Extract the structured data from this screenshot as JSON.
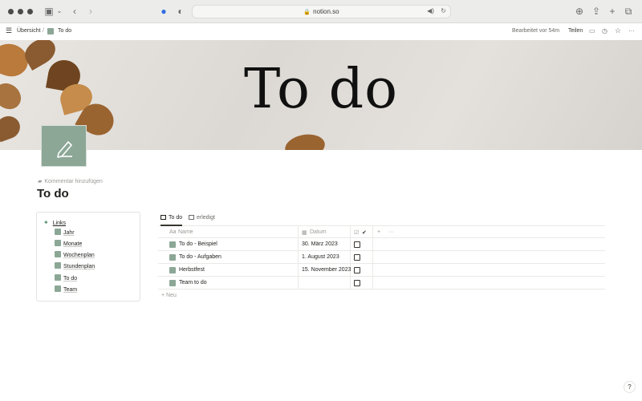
{
  "browser": {
    "url": "notion.so"
  },
  "topbar": {
    "breadcrumb_root": "Übersicht",
    "breadcrumb_sep": "/",
    "breadcrumb_page": "To do",
    "edited": "Bearbeitet vor 54m",
    "share": "Teilen"
  },
  "cover": {
    "title": "To do"
  },
  "page": {
    "comment": "Kommentar hinzufügen",
    "title": "To do"
  },
  "links": {
    "heading": "Links",
    "items": [
      "Jahr",
      "Monate",
      "Wochenplan",
      "Stundenplan",
      "To do",
      "Team"
    ]
  },
  "tabs": [
    {
      "label": "To do"
    },
    {
      "label": "erledigt"
    }
  ],
  "table": {
    "columns": {
      "name": "Name",
      "name_icon": "Aa",
      "date": "Datum",
      "check": "✔",
      "add": "+",
      "more": "···"
    },
    "rows": [
      {
        "name": "To do - Beispiel",
        "date": "30. März 2023"
      },
      {
        "name": "To do - Aufgaben",
        "date": "1. August 2023"
      },
      {
        "name": "Herbstfest",
        "date": "15. November 2023"
      },
      {
        "name": "Team to do",
        "date": ""
      }
    ],
    "new_label": "+ Neu"
  },
  "help": "?",
  "colors": {
    "accent_green": "#8ca796",
    "text": "#37352f"
  }
}
